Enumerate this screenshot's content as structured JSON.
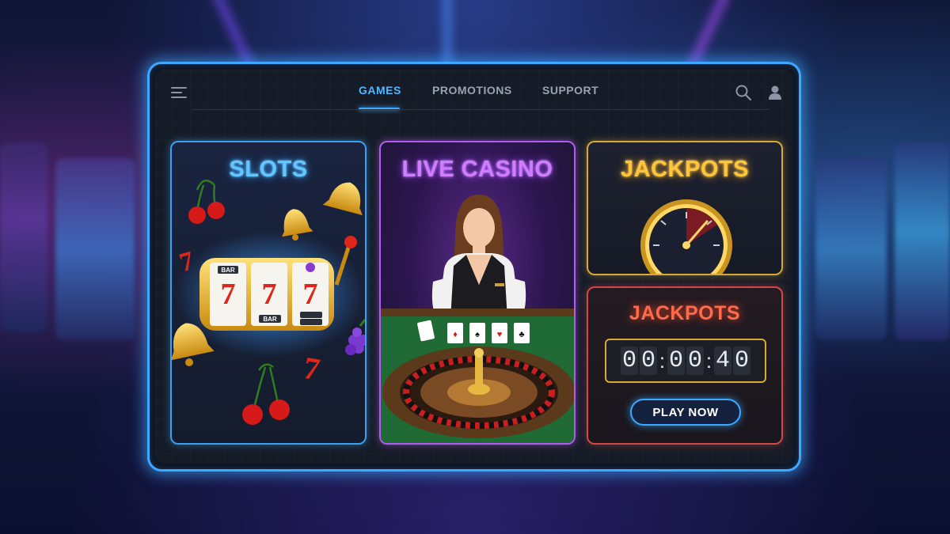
{
  "nav": {
    "tabs": [
      {
        "label": "GAMES",
        "active": true
      },
      {
        "label": "PROMOTIONS",
        "active": false
      },
      {
        "label": "SUPPORT",
        "active": false
      }
    ],
    "icons": [
      "menu-icon",
      "search-icon",
      "user-icon"
    ]
  },
  "cards": {
    "slots": {
      "title": "SLOTS"
    },
    "live_casino": {
      "title": "LIVE CASINO"
    },
    "jackpots_meter": {
      "title": "JACKPOTS"
    },
    "jackpots_timer": {
      "title": "JACKPOTS",
      "timer_digits": [
        "0",
        "0",
        "0",
        "0",
        "4",
        "0"
      ],
      "button_label": "PLAY NOW"
    }
  },
  "colors": {
    "accent_blue": "#3ca8ff",
    "slots_title": "#62c6ff",
    "live_title": "#d07cff",
    "jackpot_gold": "#ffc53a",
    "jackpot_red": "#ff6a4a"
  }
}
